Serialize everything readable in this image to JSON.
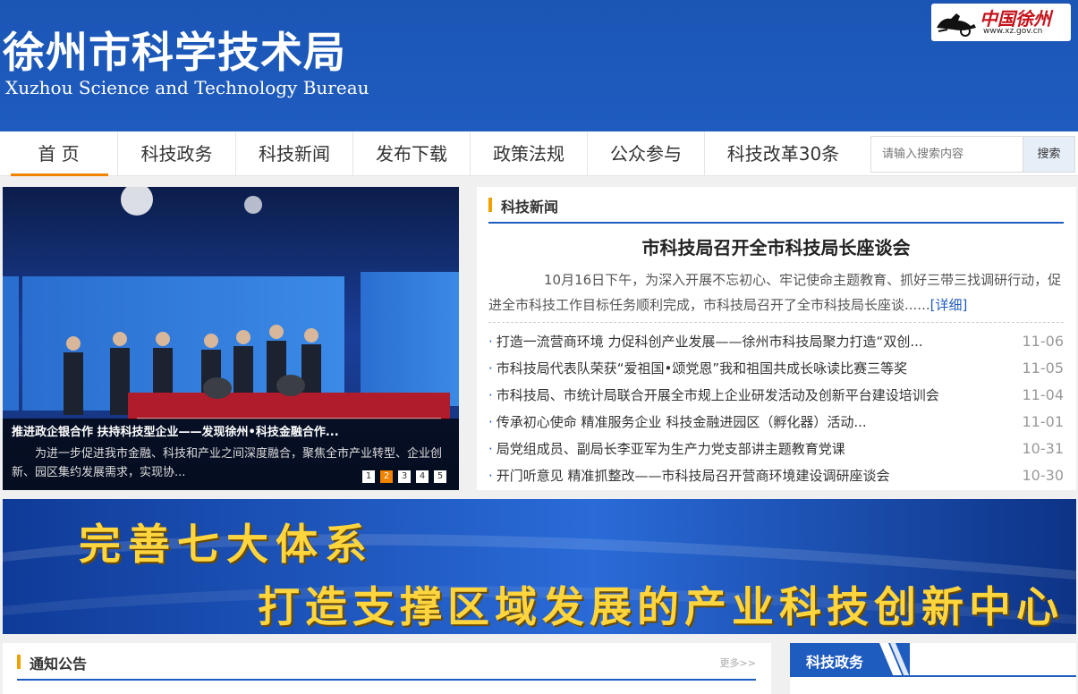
{
  "header": {
    "title": "徐州市科学技术局",
    "subtitle": "Xuzhou Science and Technology Bureau",
    "gov_logo_text": "中国徐州",
    "gov_logo_url": "www.xz.gov.cn"
  },
  "nav": {
    "items": [
      {
        "label": "首 页",
        "active": true
      },
      {
        "label": "科技政务"
      },
      {
        "label": "科技新闻"
      },
      {
        "label": "发布下载"
      },
      {
        "label": "政策法规"
      },
      {
        "label": "公众参与"
      },
      {
        "label": "科技改革30条"
      }
    ],
    "search_placeholder": "请输入搜索内容",
    "search_button": "搜索"
  },
  "slider": {
    "title": "推进政企银合作 扶持科技型企业——发现徐州•科技金融合作...",
    "desc": "为进一步促进我市金融、科技和产业之间深度融合，聚焦全市产业转型、企业创新、园区集约发展需求，实现协...",
    "pages": [
      "1",
      "2",
      "3",
      "4",
      "5"
    ],
    "active_page": 2
  },
  "news": {
    "section_title": "科技新闻",
    "headline": "市科技局召开全市科技局长座谈会",
    "summary": "10月16日下午，为深入开展不忘初心、牢记使命主题教育、抓好三带三找调研行动，促进全市科技工作目标任务顺利完成，市科技局召开了全市科技局长座谈......",
    "summary_more": "[详细]",
    "items": [
      {
        "title": "打造一流营商环境 力促科创产业发展——徐州市科技局聚力打造“双创...",
        "date": "11-06"
      },
      {
        "title": "市科技局代表队荣获“爱祖国•颂党恩”我和祖国共成长咏读比赛三等奖",
        "date": "11-05"
      },
      {
        "title": "市科技局、市统计局联合开展全市规上企业研发活动及创新平台建设培训会",
        "date": "11-04"
      },
      {
        "title": "传承初心使命 精准服务企业 科技金融进园区（孵化器）活动...",
        "date": "11-01"
      },
      {
        "title": "局党组成员、副局长李亚军为生产力党支部讲主题教育党课",
        "date": "10-31"
      },
      {
        "title": "开门听意见 精准抓整改——市科技局召开营商环境建设调研座谈会",
        "date": "10-30"
      }
    ]
  },
  "banner": {
    "line1": "完善七大体系",
    "line2": "打造支撑区域发展的产业科技创新中心"
  },
  "notice": {
    "title": "通知公告",
    "more": "更多>>"
  },
  "policy": {
    "title": "科技政务"
  },
  "colors": {
    "header_blue": "#1f5cbf",
    "nav_active": "#f08300",
    "banner_text": "#ffd53e"
  }
}
